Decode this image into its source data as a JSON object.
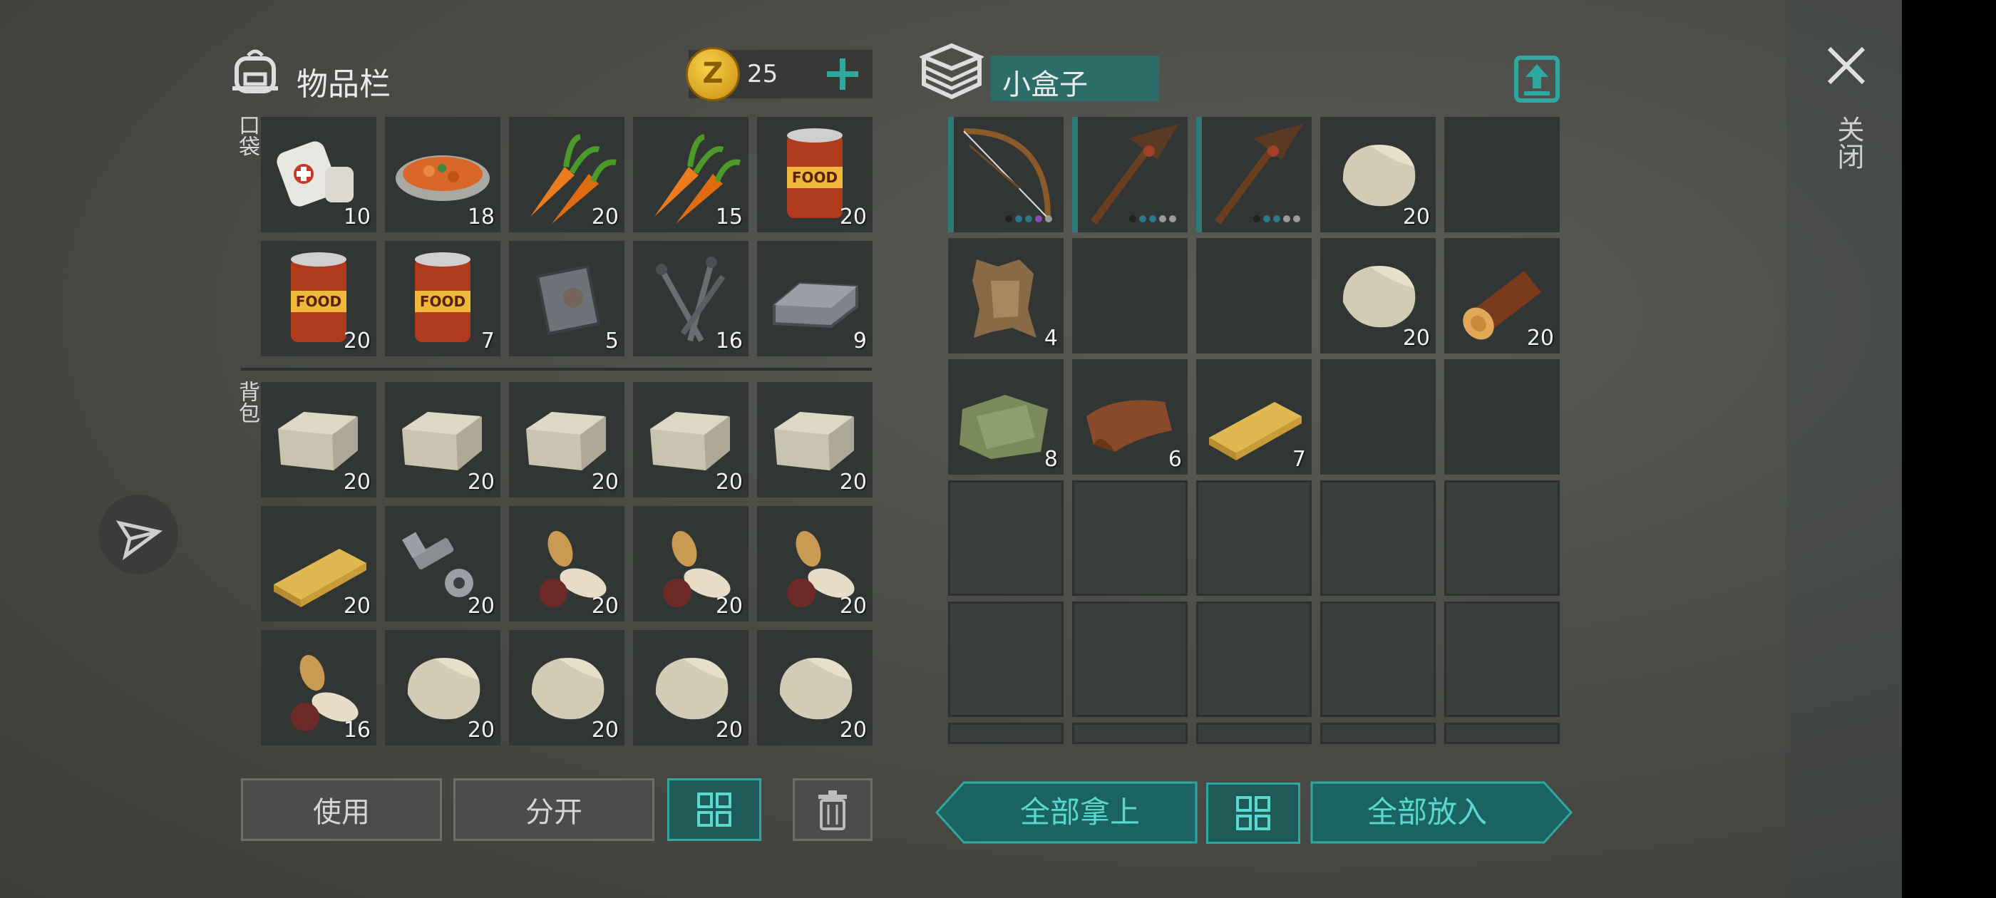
{
  "inventory": {
    "title": "物品栏",
    "coins": "25",
    "pocket_label": "口袋",
    "backpack_label": "背包",
    "pocket_items": [
      {
        "name": "bandage-item",
        "count": "10"
      },
      {
        "name": "stew-bowl-item",
        "count": "18"
      },
      {
        "name": "carrot-item",
        "count": "20"
      },
      {
        "name": "carrot-item",
        "count": "15"
      },
      {
        "name": "canned-food-item",
        "count": "20"
      },
      {
        "name": "canned-food-item",
        "count": "20"
      },
      {
        "name": "canned-food-item",
        "count": "7"
      },
      {
        "name": "iron-plate-item",
        "count": "5"
      },
      {
        "name": "nails-item",
        "count": "16"
      },
      {
        "name": "iron-ingot-item",
        "count": "9"
      }
    ],
    "backpack_items": [
      {
        "name": "stone-brick-item",
        "count": "20"
      },
      {
        "name": "stone-brick-item",
        "count": "20"
      },
      {
        "name": "stone-brick-item",
        "count": "20"
      },
      {
        "name": "stone-brick-item",
        "count": "20"
      },
      {
        "name": "stone-brick-item",
        "count": "20"
      },
      {
        "name": "wood-plank-item",
        "count": "20"
      },
      {
        "name": "bolt-nut-item",
        "count": "20"
      },
      {
        "name": "seeds-item",
        "count": "20"
      },
      {
        "name": "seeds-item",
        "count": "20"
      },
      {
        "name": "seeds-item",
        "count": "20"
      },
      {
        "name": "seeds-item",
        "count": "16"
      },
      {
        "name": "stone-item",
        "count": "20"
      },
      {
        "name": "stone-item",
        "count": "20"
      },
      {
        "name": "stone-item",
        "count": "20"
      },
      {
        "name": "stone-item",
        "count": "20"
      }
    ]
  },
  "container": {
    "title": "小盒子",
    "items": [
      {
        "name": "bow-item",
        "count": ""
      },
      {
        "name": "pickaxe-item",
        "count": ""
      },
      {
        "name": "pickaxe-item",
        "count": ""
      },
      {
        "name": "stone-item",
        "count": "20"
      },
      {
        "name": "",
        "count": ""
      },
      {
        "name": "hide-item",
        "count": "4"
      },
      {
        "name": "",
        "count": ""
      },
      {
        "name": "",
        "count": ""
      },
      {
        "name": "stone-item",
        "count": "20"
      },
      {
        "name": "log-item",
        "count": "20"
      },
      {
        "name": "cloth-item",
        "count": "8"
      },
      {
        "name": "leather-item",
        "count": "6"
      },
      {
        "name": "wood-plank-item",
        "count": "7"
      },
      {
        "name": "",
        "count": ""
      },
      {
        "name": "",
        "count": ""
      }
    ]
  },
  "buttons": {
    "use": "使用",
    "split": "分开",
    "take_all": "全部拿上",
    "put_all": "全部放入"
  },
  "close_label": "关闭",
  "colors": {
    "accent": "#2fa8a2",
    "slot": "#313634",
    "coin": "#d9a520"
  }
}
